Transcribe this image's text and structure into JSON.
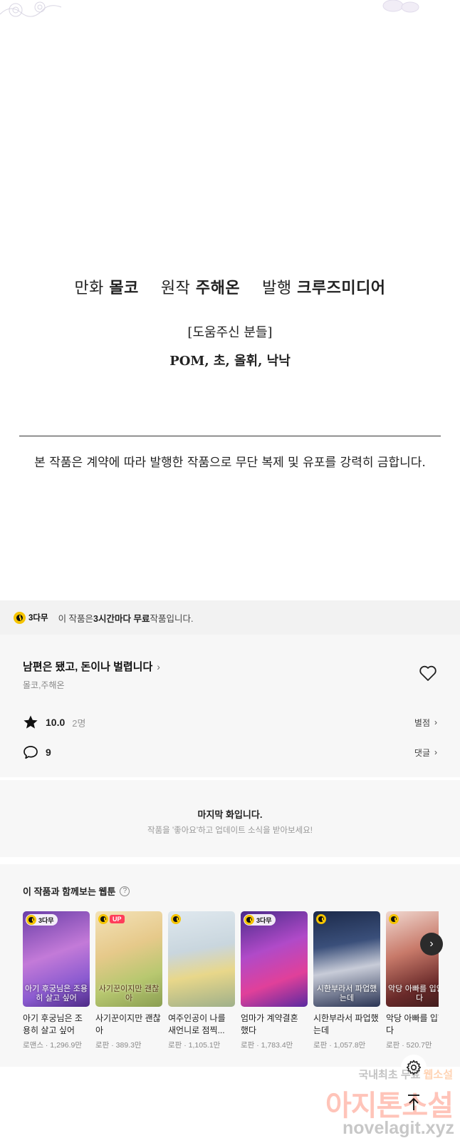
{
  "credits": {
    "art_label": "만화",
    "art_value": "몰코",
    "story_label": "원작",
    "story_value": "주해온",
    "publisher_label": "발행",
    "publisher_value": "크루즈미디어",
    "helpers_title": "[도움주신 분들]",
    "helpers_names": "POM, 초, 올휘, 낙낙",
    "notice": "본 작품은 계약에 따라 발행한 작품으로 무단 복제 및 유포를 강력히 금합니다."
  },
  "free_bar": {
    "badge": "3다무",
    "prefix": "이 작품은 ",
    "highlight": "3시간마다 무료",
    "suffix": " 작품입니다."
  },
  "series": {
    "title": "남편은 됐고, 돈이나 벌렵니다",
    "authors": "몰코,주해온",
    "rating": "10.0",
    "rating_count": "2명",
    "rating_link": "별점",
    "comments": "9",
    "comments_link": "댓글"
  },
  "last_episode": {
    "title": "마지막 화입니다.",
    "subtitle": "작품을 '좋아요'하고 업데이트 소식을 받아보세요!"
  },
  "recommendations": {
    "heading": "이 작품과 함께보는 웹툰",
    "items": [
      {
        "name": "아기 후궁님은 조용히 살고 싶어",
        "meta": "로맨스 · 1,296.9만",
        "badge": "3다무",
        "cover": "아기 후궁님은 조용히 살고 싶어"
      },
      {
        "name": "사기꾼이지만 괜찮아",
        "meta": "로판 · 389.3만",
        "badge": "UP",
        "cover": "사기꾼이지만 괜찮아"
      },
      {
        "name": "여주인공이 나를 새언니로 점찍...",
        "meta": "로판 · 1,105.1만",
        "badge": "",
        "cover": ""
      },
      {
        "name": "엄마가 계약결혼 했다",
        "meta": "로판 · 1,783.4만",
        "badge": "3다무",
        "cover": ""
      },
      {
        "name": "시한부라서 파업했는데",
        "meta": "로판 · 1,057.8만",
        "badge": "",
        "cover": "시한부라서 파업했는데"
      },
      {
        "name": "악당 아빠를 입했다",
        "meta": "로판 · 520.7만",
        "badge": "",
        "cover": "악당 아빠를 입양했다"
      }
    ]
  },
  "watermark": {
    "line1_a": "국내최초 무료",
    "line1_b": "웹소설",
    "line2": "아지톤소설",
    "line3": "novelagit.xyz"
  },
  "colors": {
    "accent_yellow": "#f5c400",
    "up_badge": "#ff3d5a",
    "panel_bg": "#f7f7f7"
  }
}
